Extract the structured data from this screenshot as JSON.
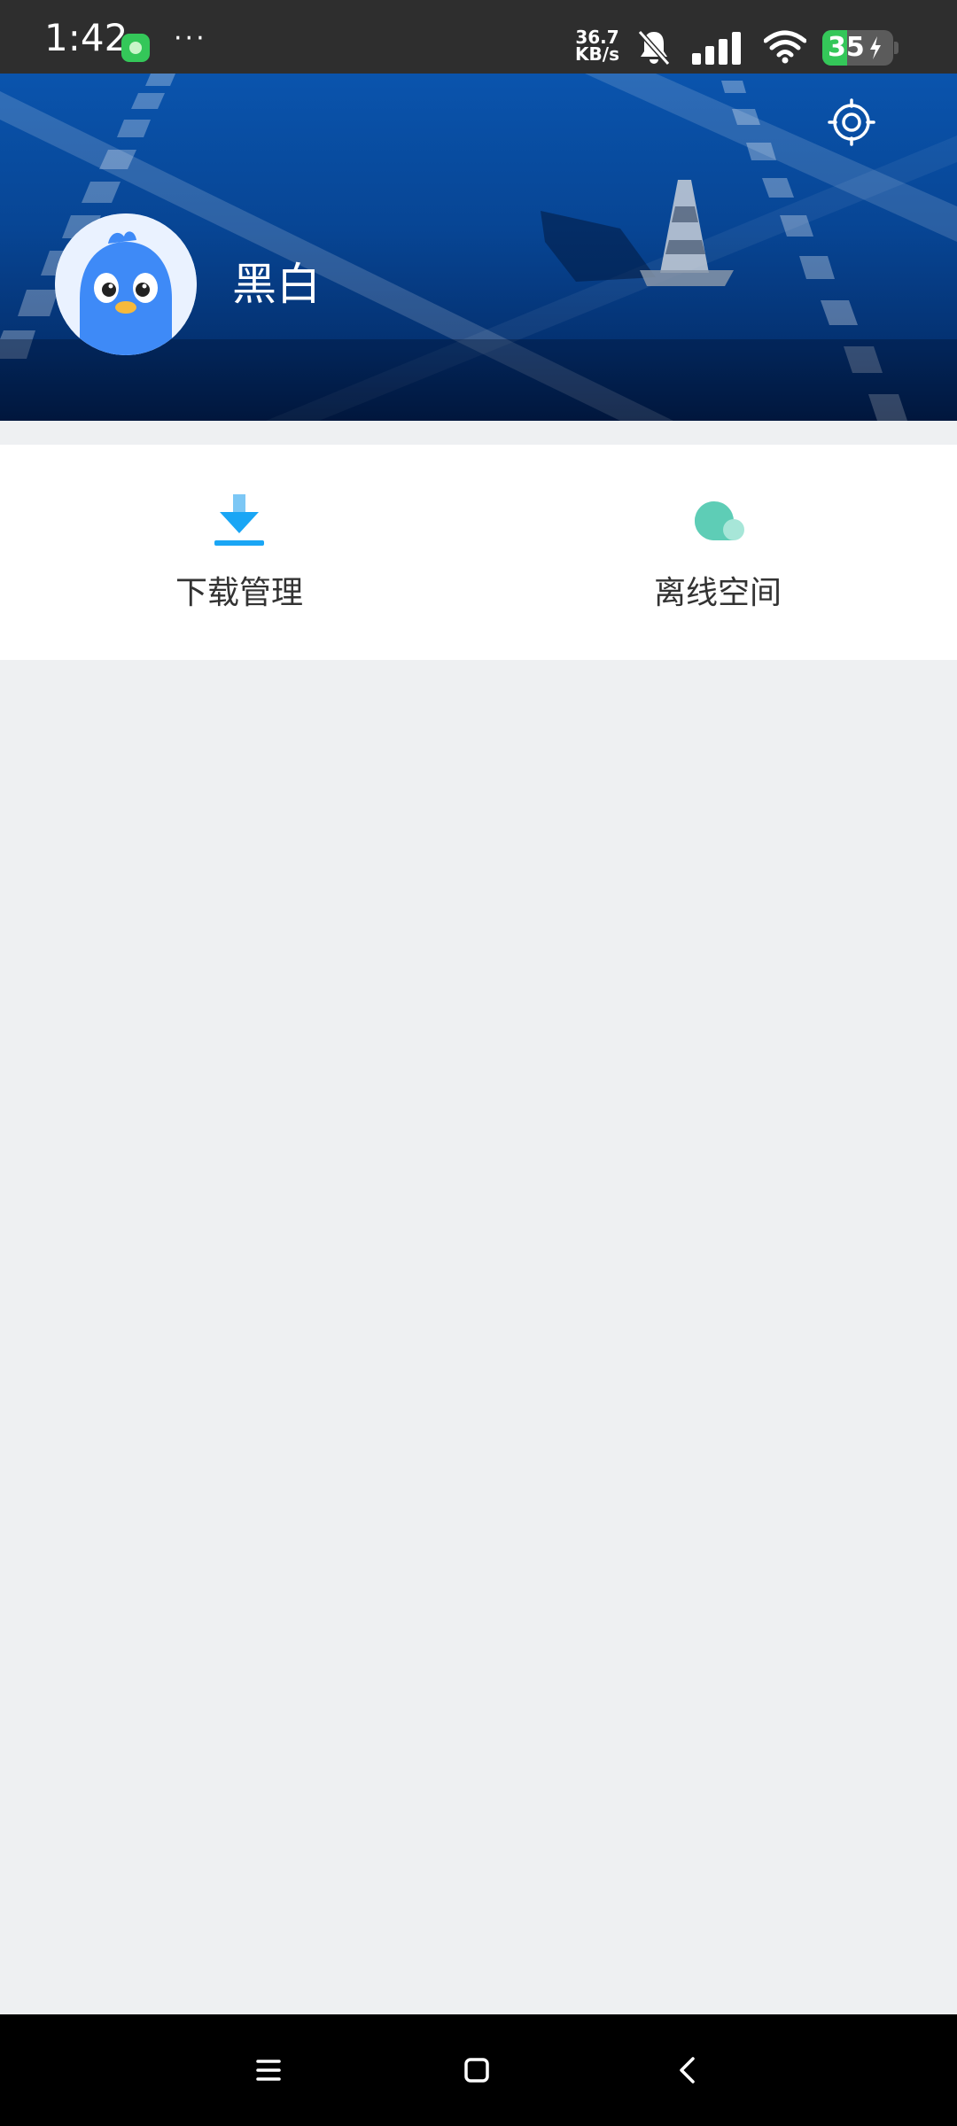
{
  "status_bar": {
    "time": "1:42",
    "more": "···",
    "net_speed_value": "36.7",
    "net_speed_unit": "KB/s",
    "battery_level": "35",
    "battery_percent": 35,
    "app_icon": "chat-app-icon",
    "bell_icon": "bell-muted-icon",
    "signal_icon": "signal-bars-icon",
    "wifi_icon": "wifi-icon"
  },
  "header": {
    "username": "黑白",
    "settings_icon": "settings-gear-icon",
    "avatar_icon": "bird-mascot-avatar",
    "banner_color": "#0a54ad"
  },
  "actions": [
    {
      "label": "下载管理",
      "icon": "download-icon",
      "color": "#1aa6f5"
    },
    {
      "label": "离线空间",
      "icon": "cloud-icon",
      "color": "#5ecdb6"
    }
  ],
  "nav": {
    "menu_icon": "menu-icon",
    "home_icon": "home-square-icon",
    "back_icon": "back-chevron-icon"
  }
}
